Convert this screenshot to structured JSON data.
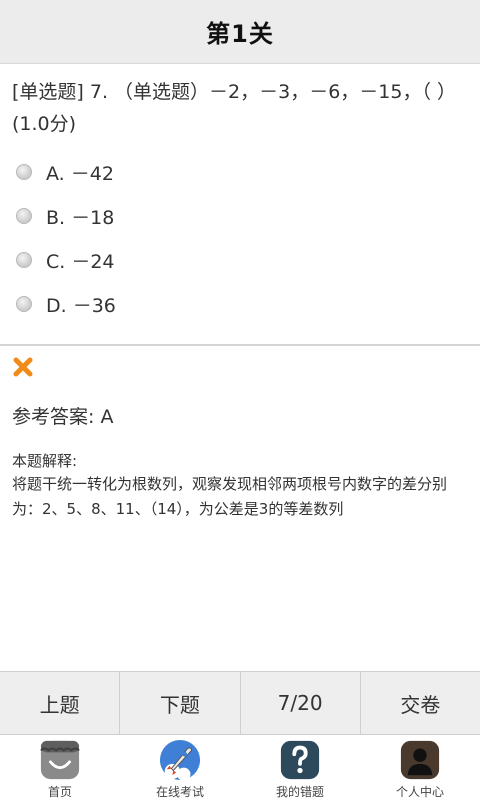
{
  "header": {
    "title": "第1关"
  },
  "question": {
    "text": "[单选题] 7. （单选题）－2，－3，－6，－15，（ ）(1.0分)"
  },
  "options": [
    {
      "label": "A. －42"
    },
    {
      "label": "B. －18"
    },
    {
      "label": "C. －24"
    },
    {
      "label": "D. －36"
    }
  ],
  "result": {
    "status_icon": "wrong-x-icon",
    "answer_label": "参考答案: A",
    "explanation_title": "本题解释:",
    "explanation_body": "将题干统一转化为根数列，观察发现相邻两项根号内数字的差分别为：2、5、8、11、（14），为公差是3的等差数列"
  },
  "actions": {
    "prev": "上题",
    "next": "下题",
    "progress": "7/20",
    "submit": "交卷"
  },
  "tabs": [
    {
      "label": "首页",
      "icon": "home-icon"
    },
    {
      "label": "在线考试",
      "icon": "rocket-icon"
    },
    {
      "label": "我的错题",
      "icon": "question-icon"
    },
    {
      "label": "个人中心",
      "icon": "user-icon"
    }
  ],
  "colors": {
    "wrong_mark": "#f08a18",
    "topbar_bg": "#ececec"
  }
}
